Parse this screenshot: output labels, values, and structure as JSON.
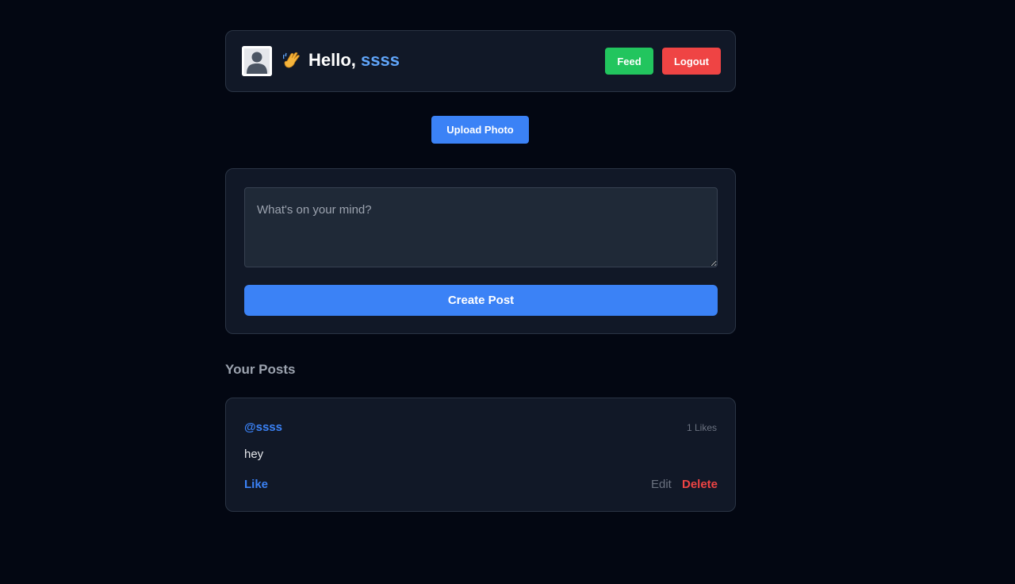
{
  "header": {
    "greeting_prefix": "Hello,",
    "username": "ssss",
    "feed_label": "Feed",
    "logout_label": "Logout"
  },
  "upload": {
    "label": "Upload Photo"
  },
  "compose": {
    "placeholder": "What's on your mind?",
    "value": "",
    "create_label": "Create Post"
  },
  "posts_section": {
    "title": "Your Posts"
  },
  "posts": [
    {
      "author": "@ssss",
      "likes": "1 Likes",
      "content": "hey",
      "like_label": "Like",
      "edit_label": "Edit",
      "delete_label": "Delete"
    }
  ],
  "colors": {
    "background": "#030712",
    "card": "#111827",
    "accent": "#3b82f6",
    "success": "#22c55e",
    "danger": "#ef4444"
  },
  "icons": {
    "avatar": "avatar-placeholder-icon",
    "wave": "waving-hand-icon"
  }
}
